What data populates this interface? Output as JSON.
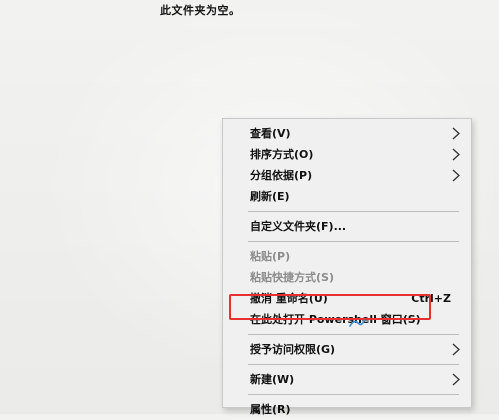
{
  "folder": {
    "empty_message": "此文件夹为空。"
  },
  "context_menu": {
    "items": [
      {
        "label": "查看(V)",
        "has_submenu": true,
        "disabled": false
      },
      {
        "label": "排序方式(O)",
        "has_submenu": true,
        "disabled": false
      },
      {
        "label": "分组依据(P)",
        "has_submenu": true,
        "disabled": false
      },
      {
        "label": "刷新(E)",
        "has_submenu": false,
        "disabled": false
      },
      {
        "label": "自定义文件夹(F)...",
        "has_submenu": false,
        "disabled": false
      },
      {
        "label": "粘贴(P)",
        "has_submenu": false,
        "disabled": true
      },
      {
        "label": "粘贴快捷方式(S)",
        "has_submenu": false,
        "disabled": true
      },
      {
        "label": "撤消 重命名(U)",
        "shortcut": "Ctrl+Z",
        "has_submenu": false,
        "disabled": false
      },
      {
        "label": "在此处打开 Powershell 窗口(S)",
        "has_submenu": false,
        "disabled": false
      },
      {
        "label": "授予访问权限(G)",
        "has_submenu": true,
        "disabled": false
      },
      {
        "label": "新建(W)",
        "has_submenu": true,
        "disabled": false
      },
      {
        "label": "属性(R)",
        "has_submenu": false,
        "disabled": false
      }
    ]
  },
  "annotation": {
    "highlight_color": "#e8302e",
    "highlighted_item": "在此处打开 Powershell 窗口(S)"
  },
  "icons": {
    "submenu": "chevron-right-icon"
  }
}
